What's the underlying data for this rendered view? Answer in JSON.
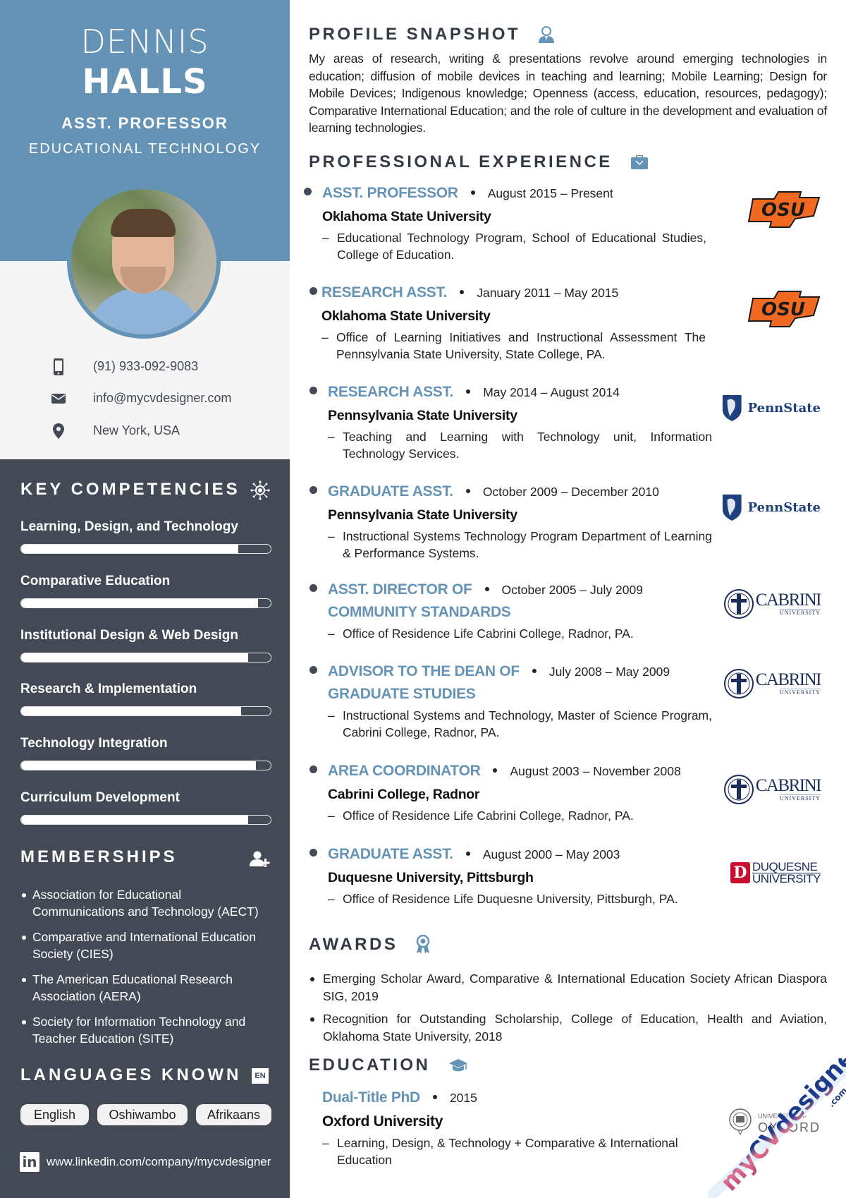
{
  "header": {
    "first_name": "DENNIS",
    "last_name": "HALLS",
    "title": "ASST. PROFESSOR",
    "department": "EDUCATIONAL TECHNOLOGY"
  },
  "contact": {
    "phone": "(91) 933-092-9083",
    "email": "info@mycvdesigner.com",
    "location": "New York, USA",
    "icons": [
      "mobile-phone-icon",
      "envelope-icon",
      "map-pin-icon"
    ]
  },
  "competencies": {
    "heading": "KEY COMPETENCIES",
    "icon": "gear-network-icon",
    "items": [
      {
        "label": "Learning, Design, and Technology",
        "level": 0.87
      },
      {
        "label": "Comparative Education",
        "level": 0.95
      },
      {
        "label": "Institutional Design & Web Design",
        "level": 0.91
      },
      {
        "label": "Research & Implementation",
        "level": 0.88
      },
      {
        "label": "Technology Integration",
        "level": 0.94
      },
      {
        "label": "Curriculum Development",
        "level": 0.91
      }
    ]
  },
  "memberships": {
    "heading": "MEMBERSHIPS",
    "icon": "add-user-icon",
    "items": [
      "Association for Educational Communications and Technology (AECT)",
      "Comparative and International Education Society (CIES)",
      "The American Educational Research Association (AERA)",
      "Society for Information Technology and Teacher Education (SITE)"
    ]
  },
  "languages": {
    "heading": "LANGUAGES KNOWN",
    "badge": "EN",
    "items": [
      "English",
      "Oshiwambo",
      "Afrikaans"
    ]
  },
  "linkedin": {
    "icon_text": "in",
    "url": "www.linkedin.com/company/mycvdesigner"
  },
  "profile": {
    "heading": "PROFILE SNAPSHOT",
    "icon": "user-icon",
    "text": "My areas of research, writing & presentations revolve around emerging technologies in education; diffusion of mobile devices in teaching and learning; Mobile Learning; Design for Mobile Devices; Indigenous knowledge; Openness (access, education, resources, pedagogy); Comparative International Education; and the role of culture in the development and evaluation of learning technologies."
  },
  "experience": {
    "heading": "PROFESSIONAL EXPERIENCE",
    "icon": "briefcase-icon",
    "items": [
      {
        "title": "ASST. PROFESSOR",
        "title2": "",
        "date": "August 2015 – Present",
        "org": "Oklahoma State University",
        "desc": "Educational Technology Program, School of Educational Studies, College of Education.",
        "logo": "OSU"
      },
      {
        "title": "RESEARCH ASST.",
        "title2": "",
        "date": "January 2011 – May 2015",
        "org": "Oklahoma State University",
        "desc": "Office of Learning Initiatives and Instructional Assessment The Pennsylvania State University, State College, PA.",
        "logo": "OSU"
      },
      {
        "title": "RESEARCH ASST.",
        "title2": "",
        "date": "May 2014 – August 2014",
        "org": "Pennsylvania State University",
        "desc": "Teaching and Learning with Technology unit, Information Technology Services.",
        "logo": "PennState"
      },
      {
        "title": "GRADUATE ASST.",
        "title2": "",
        "date": "October 2009 – December 2010",
        "org": "Pennsylvania State University",
        "desc": "Instructional Systems Technology Program Department of Learning & Performance Systems.",
        "logo": "PennState"
      },
      {
        "title": "ASST. DIRECTOR OF",
        "title2": "COMMUNITY STANDARDS",
        "date": "October 2005 – July 2009",
        "org": "",
        "desc": "Office of Residence Life Cabrini College, Radnor, PA.",
        "logo": "CABRINI"
      },
      {
        "title": "ADVISOR TO THE DEAN OF",
        "title2": "GRADUATE STUDIES",
        "date": "July 2008 – May 2009",
        "org": "",
        "desc": "Instructional Systems and Technology, Master of Science Program, Cabrini College, Radnor, PA.",
        "logo": "CABRINI"
      },
      {
        "title": "AREA COORDINATOR",
        "title2": "",
        "date": "August 2003 – November 2008",
        "org": "Cabrini College, Radnor",
        "desc": "Office of Residence Life Cabrini College, Radnor, PA.",
        "logo": "CABRINI"
      },
      {
        "title": "GRADUATE ASST.",
        "title2": "",
        "date": "August 2000 – May 2003",
        "org": "Duquesne University, Pittsburgh",
        "desc": "Office of Residence Life Duquesne University, Pittsburgh, PA.",
        "logo": "DUQUESNE"
      }
    ]
  },
  "logos": {
    "osu": "OSU",
    "pennstate": "PennState",
    "cabrini_main": "CABRINI",
    "cabrini_sub": "UNIVERSITY",
    "duquesne_line1": "DUQUESNE",
    "duquesne_line2": "UNIVERSITY",
    "oxford_line1": "UNIVERSITY OF",
    "oxford_line2": "OXFORD"
  },
  "awards": {
    "heading": "AWARDS",
    "icon": "award-ribbon-icon",
    "items": [
      "Emerging Scholar Award, Comparative & International Education Society African Diaspora SIG, 2019",
      "Recognition for Outstanding Scholarship, College of Education, Health and Aviation, Oklahoma State University, 2018"
    ]
  },
  "education": {
    "heading": "EDUCATION",
    "icon": "graduation-cap-icon",
    "items": [
      {
        "degree": "Dual-Title PhD",
        "year": "2015",
        "school": "Oxford University",
        "desc": "Learning, Design, & Technology + Comparative & International Education"
      }
    ]
  },
  "watermark": {
    "text": "myCVdesigner",
    "suffix": ".com"
  },
  "colors": {
    "accent": "#6593b6",
    "sidebar_dark": "#434a56",
    "sidebar_light": "#f5f5f5",
    "osu_orange": "#f26a21",
    "penn_blue": "#1e407c",
    "cabrini_navy": "#1d2d5a",
    "duquesne_red": "#c8102e"
  }
}
